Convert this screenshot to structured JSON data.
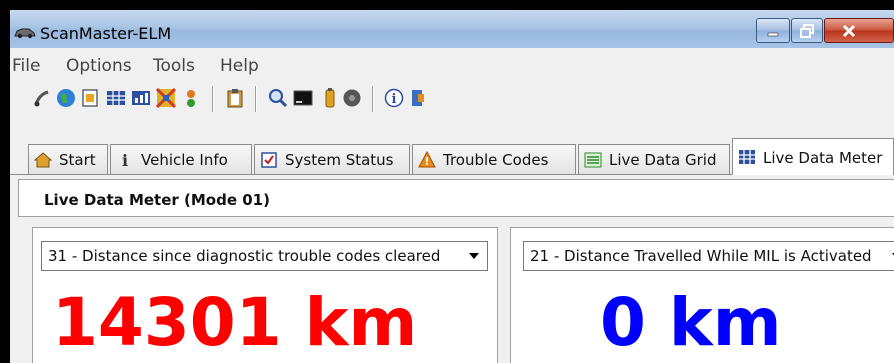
{
  "window": {
    "title": "ScanMaster-ELM"
  },
  "menu": [
    "File",
    "Options",
    "Tools",
    "Help"
  ],
  "toolbar": {
    "icons": [
      "connect-icon",
      "globe-icon",
      "info-page-icon",
      "grid-icon",
      "chart-icon",
      "map-icon",
      "sensor-icon",
      "clipboard-icon",
      "search-icon",
      "terminal-icon",
      "battery-icon",
      "disc-icon",
      "about-icon",
      "exit-icon"
    ]
  },
  "tabs": [
    {
      "label": "Start",
      "icon": "home-icon"
    },
    {
      "label": "Vehicle Info",
      "icon": "info-icon"
    },
    {
      "label": "System Status",
      "icon": "checkbox-icon"
    },
    {
      "label": "Trouble Codes",
      "icon": "warning-icon"
    },
    {
      "label": "Live Data Grid",
      "icon": "list-icon"
    },
    {
      "label": "Live Data Meter",
      "icon": "table-icon",
      "active": true
    }
  ],
  "content": {
    "title": "Live Data Meter (Mode 01)",
    "meters": [
      {
        "pid": "31 - Distance since diagnostic trouble codes cleared",
        "value": "14301 km",
        "color": "#ff0000"
      },
      {
        "pid": "21 - Distance Travelled While MIL is Activated",
        "value": "0 km",
        "color": "#0000ff"
      }
    ]
  },
  "colors": {
    "titlebar": "#a9c4e4",
    "close_button": "#c9543d",
    "meter_left": "#ff0000",
    "meter_right": "#0000ff"
  }
}
